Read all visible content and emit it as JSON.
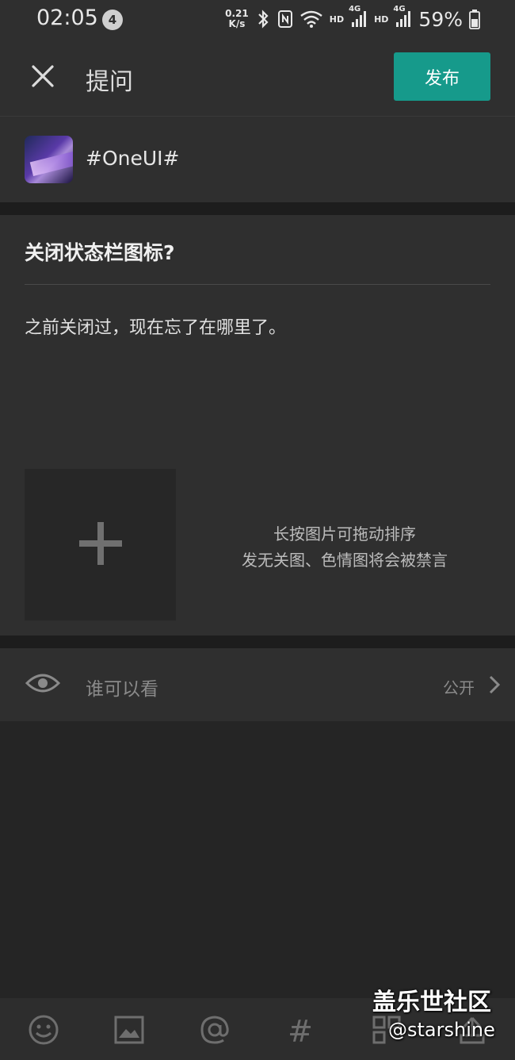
{
  "status_bar": {
    "time": "02:05",
    "notification_count": "4",
    "net_speed_value": "0.21",
    "net_speed_unit": "K/s",
    "hd_label_1": "HD",
    "network_1": "4G",
    "hd_label_2": "HD",
    "network_2": "4G",
    "battery": "59%"
  },
  "header": {
    "title": "提问",
    "publish_label": "发布"
  },
  "topic": {
    "tag": "#OneUI#"
  },
  "question": {
    "title": "关闭状态栏图标?",
    "body": "之前关闭过，现在忘了在哪里了。"
  },
  "image_upload": {
    "hint_line1": "长按图片可拖动排序",
    "hint_line2": "发无关图、色情图将会被禁言"
  },
  "privacy": {
    "label": "谁可以看",
    "value": "公开"
  },
  "toolbar": {
    "hash_symbol": "#"
  },
  "watermark": {
    "title": "盖乐世社区",
    "handle": "@starshine"
  },
  "colors": {
    "accent": "#169a8b",
    "background": "#252525",
    "panel": "#2f2f2f"
  }
}
